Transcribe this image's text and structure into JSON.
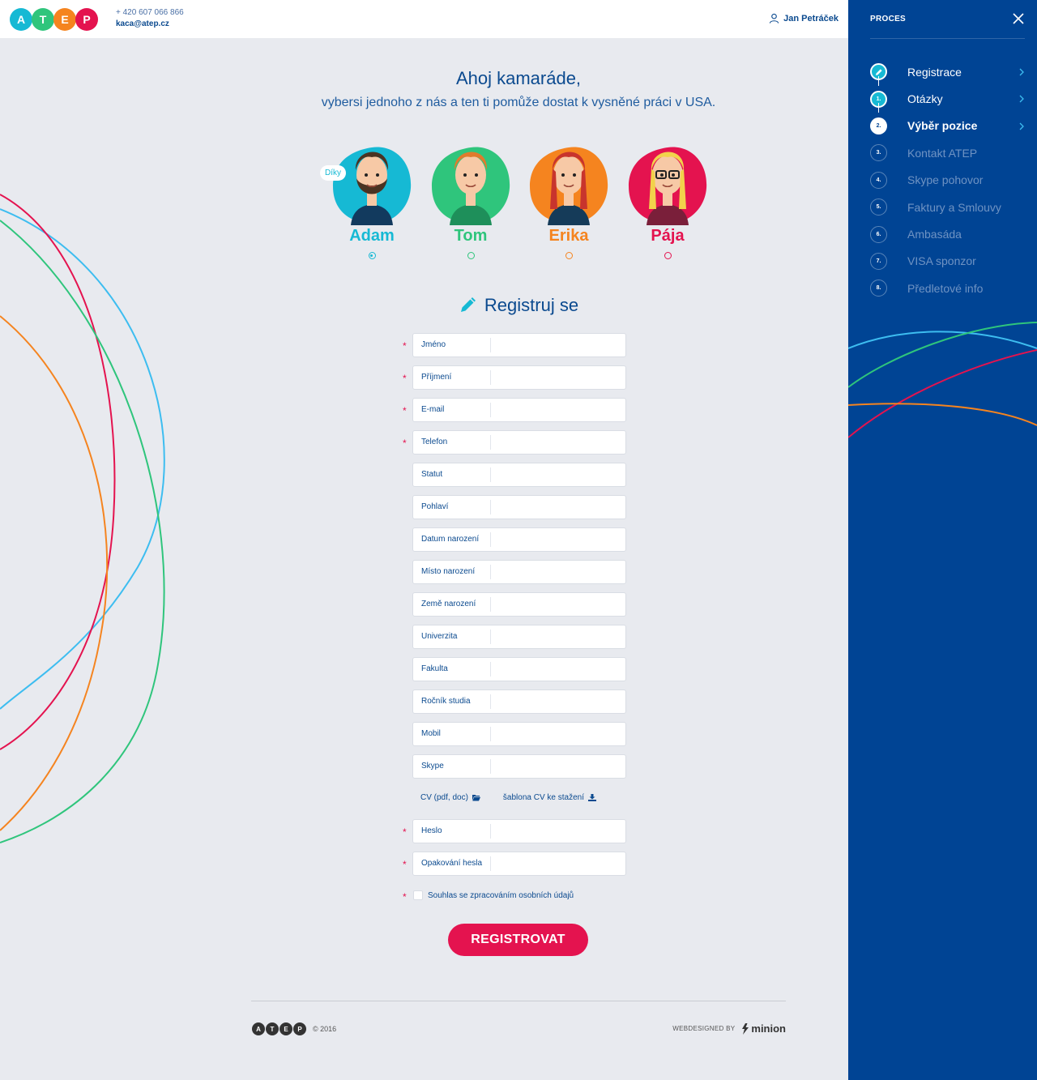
{
  "header": {
    "logo_letters": [
      "A",
      "T",
      "E",
      "P"
    ],
    "logo_colors": [
      "#16b9d4",
      "#2fc57c",
      "#f5841f",
      "#e4134f"
    ],
    "phone": "+ 420 607 066 866",
    "email": "kaca@atep.cz",
    "user_name": "Jan Petráček"
  },
  "sidebar": {
    "title": "PROCES",
    "steps": [
      {
        "number": "",
        "label": "Registrace",
        "state": "done"
      },
      {
        "number": "1.",
        "label": "Otázky",
        "state": "done"
      },
      {
        "number": "2.",
        "label": "Výběr pozice",
        "state": "current"
      },
      {
        "number": "3.",
        "label": "Kontakt ATEP",
        "state": "pending"
      },
      {
        "number": "4.",
        "label": "Skype pohovor",
        "state": "pending"
      },
      {
        "number": "5.",
        "label": "Faktury a Smlouvy",
        "state": "pending"
      },
      {
        "number": "6.",
        "label": "Ambasáda",
        "state": "pending"
      },
      {
        "number": "7.",
        "label": "VISA sponzor",
        "state": "pending"
      },
      {
        "number": "8.",
        "label": "Předletové info",
        "state": "pending"
      }
    ]
  },
  "greeting": {
    "title": "Ahoj kamaráde,",
    "subtitle": "vybersi jednoho z nás a ten ti pomůže dostat k vysněné práci v USA."
  },
  "avatars": [
    {
      "name": "Adam",
      "color": "#16b9d4",
      "selected": true,
      "speech": "Díky"
    },
    {
      "name": "Tom",
      "color": "#2fc57c",
      "selected": false
    },
    {
      "name": "Erika",
      "color": "#f5841f",
      "selected": false
    },
    {
      "name": "Pája",
      "color": "#e4134f",
      "selected": false
    }
  ],
  "form": {
    "title": "Registruj se",
    "fields": [
      {
        "label": "Jméno",
        "required": true,
        "value": ""
      },
      {
        "label": "Příjmení",
        "required": true,
        "value": ""
      },
      {
        "label": "E-mail",
        "required": true,
        "value": ""
      },
      {
        "label": "Telefon",
        "required": true,
        "value": ""
      },
      {
        "label": "Statut",
        "required": false,
        "value": ""
      },
      {
        "label": "Pohlaví",
        "required": false,
        "value": ""
      },
      {
        "label": "Datum narození",
        "required": false,
        "value": ""
      },
      {
        "label": "Místo narození",
        "required": false,
        "value": ""
      },
      {
        "label": "Země narození",
        "required": false,
        "value": ""
      },
      {
        "label": "Univerzita",
        "required": false,
        "value": ""
      },
      {
        "label": "Fakulta",
        "required": false,
        "value": ""
      },
      {
        "label": "Ročník studia",
        "required": false,
        "value": ""
      },
      {
        "label": "Mobil",
        "required": false,
        "value": ""
      },
      {
        "label": "Skype",
        "required": false,
        "value": ""
      }
    ],
    "cv_upload_label": "CV (pdf, doc)",
    "cv_template_label": "šablona CV ke stažení",
    "password_fields": [
      {
        "label": "Heslo",
        "required": true,
        "value": ""
      },
      {
        "label": "Opakování hesla",
        "required": true,
        "value": ""
      }
    ],
    "required_mark": "*",
    "consent_label": "Souhlas se zpracováním osobních údajů",
    "submit_label": "REGISTROVAT"
  },
  "footer": {
    "logo_letters": [
      "A",
      "T",
      "E",
      "P"
    ],
    "copyright": "© 2016",
    "credit_prefix": "WEBDESIGNED BY",
    "credit_brand": "minion"
  }
}
